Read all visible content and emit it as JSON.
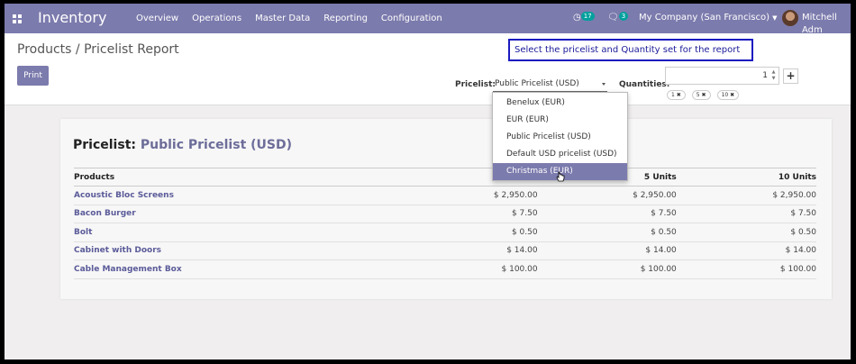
{
  "navbar": {
    "app_name": "Inventory",
    "menu": [
      "Overview",
      "Operations",
      "Master Data",
      "Reporting",
      "Configuration"
    ],
    "activity_count": "17",
    "message_count": "3",
    "company": "My Company (San Francisco)",
    "user": "Mitchell Adm",
    "color": "#7c7bad"
  },
  "control": {
    "breadcrumb": "Products / Pricelist Report",
    "print_label": "Print",
    "callout": "Select the pricelist and Quantity set for the report",
    "pricelist_label": "Pricelist:",
    "pricelist_value": "Public Pricelist (USD)",
    "quantities_label": "Quantities:",
    "quantity_value": "1",
    "add_icon": "+",
    "quantity_tags": [
      "1",
      "5",
      "10"
    ]
  },
  "dropdown": {
    "options": [
      "Benelux (EUR)",
      "EUR (EUR)",
      "Public Pricelist (USD)",
      "Default USD pricelist (USD)",
      "Christmas (EUR)"
    ],
    "highlighted": "Christmas (EUR)"
  },
  "report": {
    "title_label": "Pricelist:",
    "title_value": "Public Pricelist (USD)",
    "headers": [
      "Products",
      "",
      "5 Units",
      "10 Units"
    ],
    "rows": [
      [
        "Acoustic Bloc Screens",
        "$ 2,950.00",
        "$ 2,950.00",
        "$ 2,950.00"
      ],
      [
        "Bacon Burger",
        "$ 7.50",
        "$ 7.50",
        "$ 7.50"
      ],
      [
        "Bolt",
        "$ 0.50",
        "$ 0.50",
        "$ 0.50"
      ],
      [
        "Cabinet with Doors",
        "$ 14.00",
        "$ 14.00",
        "$ 14.00"
      ],
      [
        "Cable Management Box",
        "$ 100.00",
        "$ 100.00",
        "$ 100.00"
      ]
    ]
  }
}
